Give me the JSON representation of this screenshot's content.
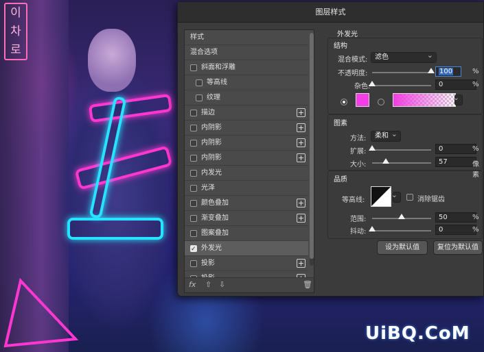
{
  "dialog": {
    "title": "图层样式"
  },
  "styles_panel": {
    "header": "样式",
    "blend_options": "混合选项",
    "items": [
      {
        "label": "斜面和浮雕",
        "checked": false,
        "indent": false,
        "plus": false
      },
      {
        "label": "等高线",
        "checked": false,
        "indent": true,
        "plus": false
      },
      {
        "label": "纹理",
        "checked": false,
        "indent": true,
        "plus": false
      },
      {
        "label": "描边",
        "checked": false,
        "indent": false,
        "plus": true
      },
      {
        "label": "内阴影",
        "checked": false,
        "indent": false,
        "plus": true
      },
      {
        "label": "内阴影",
        "checked": false,
        "indent": false,
        "plus": true
      },
      {
        "label": "内阴影",
        "checked": false,
        "indent": false,
        "plus": true
      },
      {
        "label": "内发光",
        "checked": false,
        "indent": false,
        "plus": false
      },
      {
        "label": "光泽",
        "checked": false,
        "indent": false,
        "plus": false
      },
      {
        "label": "颜色叠加",
        "checked": false,
        "indent": false,
        "plus": true
      },
      {
        "label": "渐变叠加",
        "checked": false,
        "indent": false,
        "plus": true
      },
      {
        "label": "图案叠加",
        "checked": false,
        "indent": false,
        "plus": false
      },
      {
        "label": "外发光",
        "checked": true,
        "indent": false,
        "plus": false,
        "selected": true
      },
      {
        "label": "投影",
        "checked": false,
        "indent": false,
        "plus": true
      },
      {
        "label": "投影",
        "checked": false,
        "indent": false,
        "plus": true
      }
    ],
    "footer": {
      "fx": "fx",
      "up_icon": "arrow-up-icon",
      "down_icon": "arrow-down-icon",
      "trash_icon": "trash-icon"
    }
  },
  "outer_glow": {
    "title": "外发光",
    "structure": {
      "title": "结构",
      "blend_mode_label": "混合模式:",
      "blend_mode_value": "滤色",
      "opacity_label": "不透明度:",
      "opacity_value": "100",
      "opacity_percent": 100,
      "noise_label": "杂色:",
      "noise_value": "0",
      "noise_percent": 0,
      "color": "#f23ee6",
      "percent": "%"
    },
    "elements": {
      "title": "图素",
      "method_label": "方法:",
      "method_value": "柔和",
      "spread_label": "扩展:",
      "spread_value": "0",
      "spread_percent": 0,
      "size_label": "大小:",
      "size_value": "57",
      "size_fraction": 0.23,
      "size_unit": "像素",
      "percent": "%"
    },
    "quality": {
      "title": "品质",
      "contour_label": "等高线:",
      "antialias_label": "消除锯齿",
      "range_label": "范围:",
      "range_value": "50",
      "range_percent": 50,
      "jitter_label": "抖动:",
      "jitter_value": "0",
      "jitter_percent": 0,
      "percent": "%"
    },
    "buttons": {
      "set_default": "设为默认值",
      "reset_default": "复位为默认值"
    }
  },
  "background": {
    "sign_text": "이 차 로",
    "watermark": "UiBQ.CoM"
  }
}
